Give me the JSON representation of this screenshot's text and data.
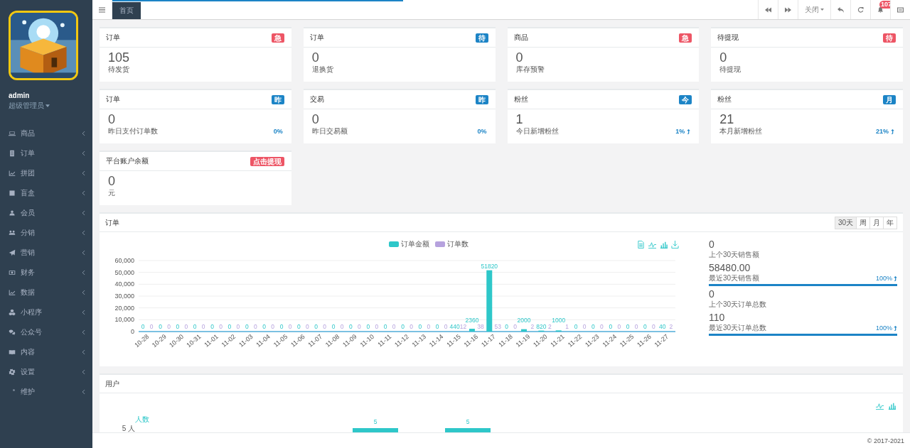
{
  "sidebar": {
    "user": {
      "name": "admin",
      "role": "超级管理员"
    },
    "items": [
      {
        "label": "商品"
      },
      {
        "label": "订单"
      },
      {
        "label": "拼团"
      },
      {
        "label": "盲盒"
      },
      {
        "label": "会员"
      },
      {
        "label": "分销"
      },
      {
        "label": "营销"
      },
      {
        "label": "财务"
      },
      {
        "label": "数据"
      },
      {
        "label": "小程序"
      },
      {
        "label": "公众号"
      },
      {
        "label": "内容"
      },
      {
        "label": "设置"
      },
      {
        "label": "维护"
      }
    ]
  },
  "loading_bar": {
    "level": 0.38
  },
  "tabs": [
    {
      "label": "首页",
      "selected": true
    }
  ],
  "toolbar": {
    "close_menu": "关闭",
    "notification_count": "107"
  },
  "cards": [
    {
      "title": "订单",
      "badge": {
        "text": "急",
        "color": "#ed5565"
      },
      "value": "105",
      "label": "待发货"
    },
    {
      "title": "订单",
      "badge": {
        "text": "待",
        "color": "#1c84c6"
      },
      "value": "0",
      "label": "退换货"
    },
    {
      "title": "商品",
      "badge": {
        "text": "急",
        "color": "#ed5565"
      },
      "value": "0",
      "label": "库存预警"
    },
    {
      "title": "待提现",
      "badge": {
        "text": "待",
        "color": "#ed5565"
      },
      "value": "0",
      "label": "待提现"
    },
    {
      "title": "订单",
      "badge": {
        "text": "昨",
        "color": "#1c84c6"
      },
      "value": "0",
      "label": "昨日支付订单数",
      "percent": "0%",
      "trend_up": false
    },
    {
      "title": "交易",
      "badge": {
        "text": "昨",
        "color": "#1c84c6"
      },
      "value": "0",
      "label": "昨日交易额",
      "percent": "0%",
      "trend_up": false
    },
    {
      "title": "粉丝",
      "badge": {
        "text": "今",
        "color": "#1c84c6"
      },
      "value": "1",
      "label": "今日新增粉丝",
      "percent": "1%",
      "trend_up": true
    },
    {
      "title": "粉丝",
      "badge": {
        "text": "月",
        "color": "#1c84c6"
      },
      "value": "21",
      "label": "本月新增粉丝",
      "percent": "21%",
      "trend_up": true
    },
    {
      "title": "平台账户余额",
      "badge": {
        "text": "点击提现",
        "color": "#ed5565"
      },
      "value": "0",
      "label": "元"
    }
  ],
  "orders_panel": {
    "title": "订单",
    "periods": [
      {
        "label": "30天",
        "selected": true
      },
      {
        "label": "周",
        "selected": false
      },
      {
        "label": "月",
        "selected": false
      },
      {
        "label": "年",
        "selected": false
      }
    ],
    "chart_data": {
      "type": "bar",
      "categories": [
        "10-28",
        "10-29",
        "10-30",
        "10-31",
        "11-01",
        "11-02",
        "11-03",
        "11-04",
        "11-05",
        "11-06",
        "11-07",
        "11-08",
        "11-09",
        "11-10",
        "11-11",
        "11-12",
        "11-13",
        "11-14",
        "11-15",
        "11-16",
        "11-17",
        "11-18",
        "11-19",
        "11-20",
        "11-21",
        "11-22",
        "11-23",
        "11-24",
        "11-25",
        "11-26",
        "11-27"
      ],
      "series": [
        {
          "name": "订单金额",
          "color": "#2ec7c9",
          "values": [
            0,
            0,
            0,
            0,
            0,
            0,
            0,
            0,
            0,
            0,
            0,
            0,
            0,
            0,
            0,
            0,
            0,
            0,
            440,
            2360,
            51820,
            0,
            2000,
            820,
            1000,
            0,
            0,
            0,
            0,
            0,
            40
          ]
        },
        {
          "name": "订单数",
          "color": "#b6a2de",
          "values": [
            0,
            0,
            0,
            0,
            0,
            0,
            0,
            0,
            0,
            0,
            0,
            0,
            0,
            0,
            0,
            0,
            0,
            0,
            12,
            38,
            53,
            0,
            2,
            2,
            1,
            0,
            0,
            0,
            0,
            0,
            2
          ]
        }
      ],
      "ylim": [
        0,
        60000
      ],
      "yticks": [
        {
          "value": 0,
          "label": "0"
        },
        {
          "value": 10000,
          "label": "10,000"
        },
        {
          "value": 20000,
          "label": "20,000"
        },
        {
          "value": 30000,
          "label": "30,000"
        },
        {
          "value": 40000,
          "label": "40,000"
        },
        {
          "value": 50000,
          "label": "50,000"
        },
        {
          "value": 60000,
          "label": "60,000"
        }
      ],
      "data_labels": true,
      "grid": true,
      "legend": "top"
    },
    "stats": [
      {
        "value": "0",
        "label": "上个30天销售额"
      },
      {
        "value": "58480.00",
        "label": "最近30天销售额",
        "percent": "100%",
        "level": 1
      },
      {
        "value": "0",
        "label": "上个30天订单总数"
      },
      {
        "value": "110",
        "label": "最近30天订单总数",
        "percent": "100%",
        "level": 1
      }
    ]
  },
  "users_panel": {
    "title": "用户",
    "y_axis_title": "人数",
    "y_tick": "5 人",
    "bar_labels": [
      "5",
      "5"
    ]
  },
  "footer": "© 2017-2021"
}
